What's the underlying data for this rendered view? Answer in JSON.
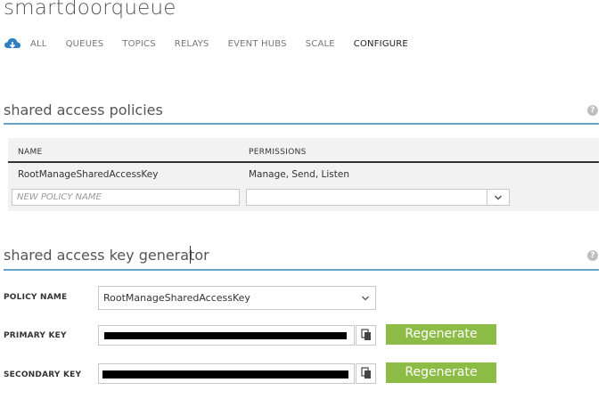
{
  "header": {
    "title": "smartdoorqueue"
  },
  "nav": {
    "items": [
      "ALL",
      "QUEUES",
      "TOPICS",
      "RELAYS",
      "EVENT HUBS",
      "SCALE",
      "CONFIGURE"
    ],
    "active_index": 6
  },
  "policies": {
    "title": "shared access policies",
    "columns": {
      "name": "NAME",
      "permissions": "PERMISSIONS"
    },
    "rows": [
      {
        "name": "RootManageSharedAccessKey",
        "permissions": "Manage, Send, Listen"
      }
    ],
    "new_policy": {
      "name_value": "",
      "name_placeholder": "NEW POLICY NAME",
      "permissions_value": ""
    }
  },
  "generator": {
    "title": "shared access key generator",
    "policy_name_label": "POLICY NAME",
    "policy_name_value": "RootManageSharedAccessKey",
    "primary_key_label": "PRIMARY KEY",
    "secondary_key_label": "SECONDARY KEY",
    "regenerate_label": "Regenerate"
  },
  "help_glyph": "?",
  "colors": {
    "accent_line": "#6aa3c8",
    "regenerate_button": "#8cbc45",
    "brand_cloud": "#2f7fc1"
  }
}
